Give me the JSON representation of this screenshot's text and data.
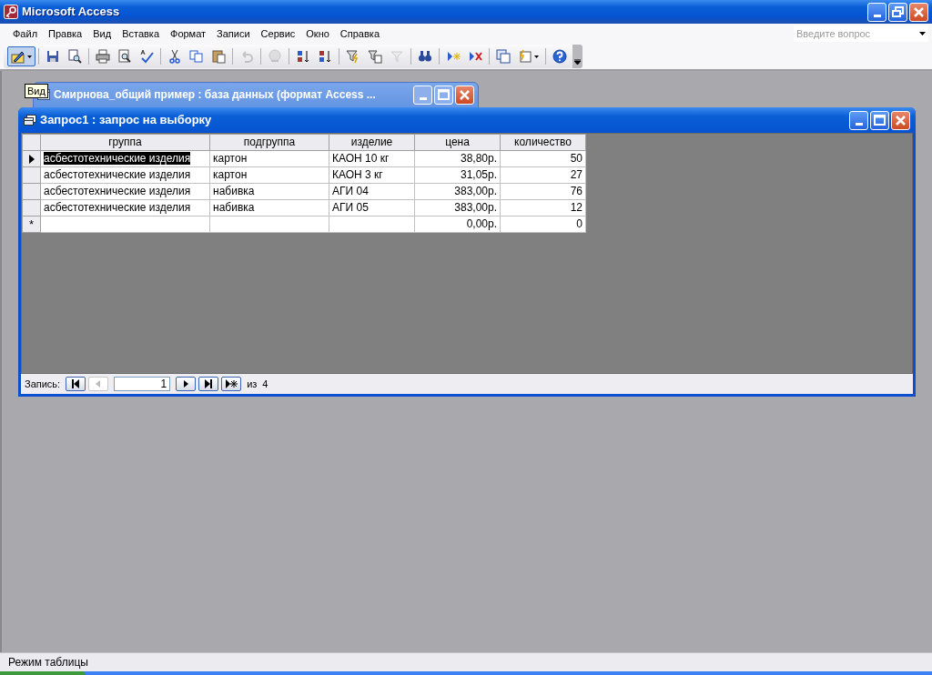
{
  "app_window": {
    "title": "Microsoft Access"
  },
  "menu": [
    "Файл",
    "Правка",
    "Вид",
    "Вставка",
    "Формат",
    "Записи",
    "Сервис",
    "Окно",
    "Справка"
  ],
  "question_box": {
    "placeholder": "Введите вопрос"
  },
  "toolbar": [
    {
      "kind": "view",
      "pressed": true
    },
    {
      "kind": "separator"
    },
    {
      "kind": "save",
      "disabled": false
    },
    {
      "kind": "file-search",
      "disabled": false
    },
    {
      "kind": "separator"
    },
    {
      "kind": "print",
      "disabled": false
    },
    {
      "kind": "preview",
      "disabled": false
    },
    {
      "kind": "spelling",
      "disabled": false
    },
    {
      "kind": "separator"
    },
    {
      "kind": "cut",
      "disabled": false
    },
    {
      "kind": "copy",
      "disabled": false
    },
    {
      "kind": "paste",
      "disabled": false
    },
    {
      "kind": "separator"
    },
    {
      "kind": "undo",
      "disabled": true
    },
    {
      "kind": "separator"
    },
    {
      "kind": "hyperlink",
      "disabled": true
    },
    {
      "kind": "separator"
    },
    {
      "kind": "sort-asc",
      "disabled": false
    },
    {
      "kind": "sort-desc",
      "disabled": false
    },
    {
      "kind": "separator"
    },
    {
      "kind": "filter-selection",
      "disabled": false
    },
    {
      "kind": "filter-form",
      "disabled": false
    },
    {
      "kind": "apply-filter",
      "disabled": true
    },
    {
      "kind": "separator"
    },
    {
      "kind": "find",
      "disabled": false
    },
    {
      "kind": "separator"
    },
    {
      "kind": "new-record",
      "disabled": false
    },
    {
      "kind": "delete-record",
      "disabled": false
    },
    {
      "kind": "separator"
    },
    {
      "kind": "database-window",
      "disabled": false
    },
    {
      "kind": "new-object",
      "disabled": false
    },
    {
      "kind": "separator"
    },
    {
      "kind": "help",
      "disabled": false
    }
  ],
  "tooltip": "Вид",
  "database_window": {
    "title": "Смирнова_общий пример : база данных (формат Access ..."
  },
  "query_window": {
    "title": "Запрос1 : запрос на выборку",
    "table": {
      "columns": [
        "группа",
        "подгруппа",
        "изделие",
        "цена",
        "количество"
      ],
      "rows": [
        {
          "selected": true,
          "cells": [
            "асбестотехнические изделия",
            "картон",
            "КАОН 10 кг",
            "38,80р.",
            "50"
          ]
        },
        {
          "selected": false,
          "cells": [
            "асбестотехнические изделия",
            "картон",
            "КАОН 3 кг",
            "31,05р.",
            "27"
          ]
        },
        {
          "selected": false,
          "cells": [
            "асбестотехнические изделия",
            "набивка",
            "АГИ 04",
            "383,00р.",
            "76"
          ]
        },
        {
          "selected": false,
          "cells": [
            "асбестотехнические изделия",
            "набивка",
            "АГИ 05",
            "383,00р.",
            "12"
          ]
        }
      ],
      "new_row": {
        "marker": "*",
        "price": "0,00р.",
        "quantity": "0"
      }
    },
    "navigator": {
      "label": "Запись:",
      "current": "1",
      "of_label": "из",
      "total": "4",
      "first_disabled": false,
      "prev_disabled": true
    }
  },
  "status_bar": "Режим таблицы"
}
